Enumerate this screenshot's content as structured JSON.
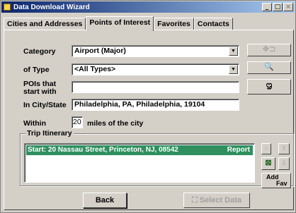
{
  "window": {
    "title": "Data Download Wizard"
  },
  "tabs": [
    {
      "label": "Cities and Addresses"
    },
    {
      "label": "Points of Interest"
    },
    {
      "label": "Favorites"
    },
    {
      "label": "Contacts"
    }
  ],
  "form": {
    "category_label": "Category",
    "category_value": "Airport (Major)",
    "type_label": "of Type",
    "type_value": "<All Types>",
    "poi_label_1": "POIs that",
    "poi_label_2": "start with",
    "poi_value": "",
    "city_label": "In City/State",
    "city_value": "Philadelphia, PA, Philadelphia, 19104",
    "within_label": "Within",
    "within_value": "20",
    "within_suffix": "miles of the city"
  },
  "itinerary": {
    "label": "Trip Itinerary",
    "rows": [
      {
        "text": "Start: 20 Nassau Street, Princeton, NJ, 08542",
        "status": "Report"
      }
    ]
  },
  "side_buttons": {
    "add_fav_line1": "Add",
    "add_fav_line2": "Fav"
  },
  "buttons": {
    "back": "Back",
    "select_data": "Select Data"
  }
}
